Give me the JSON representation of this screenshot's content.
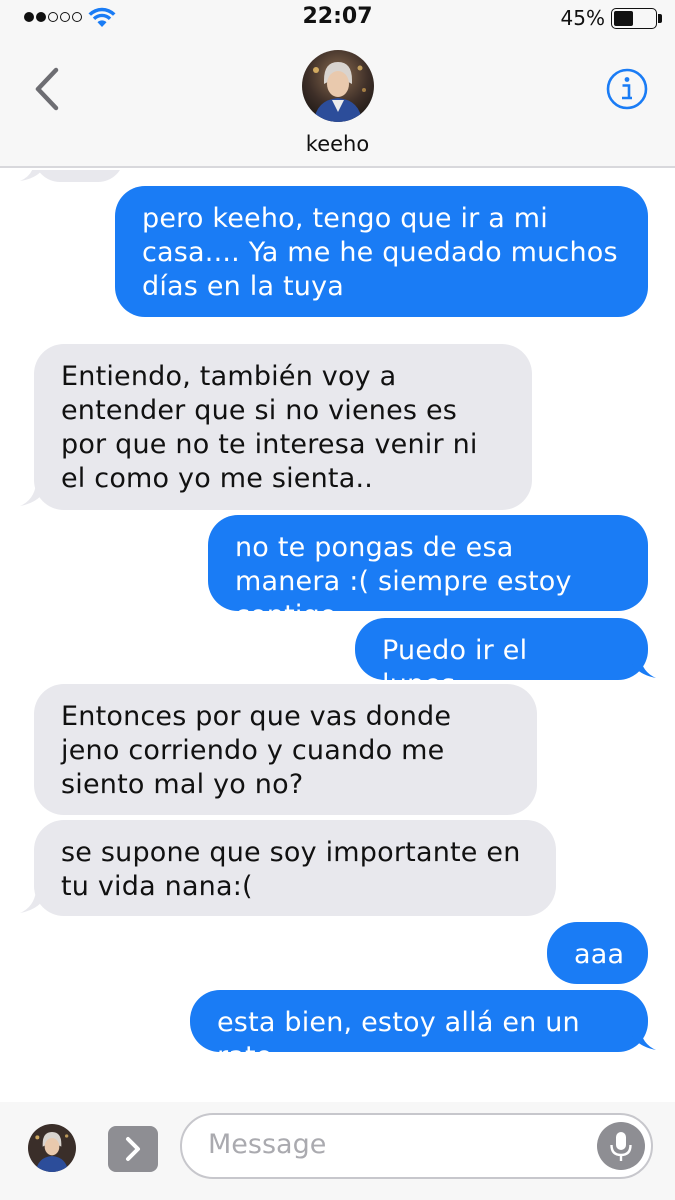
{
  "status_bar": {
    "time": "22:07",
    "battery_percent": "45%",
    "battery_level": 0.45,
    "signal_bars_filled": 2,
    "signal_bars_total": 5
  },
  "header": {
    "contact_name": "keeho",
    "back_icon": "chevron-left-icon",
    "info_icon": "info-icon"
  },
  "messages": [
    {
      "side": "sent",
      "text": "pero keeho, tengo que ir a mi casa.... Ya me he quedado muchos días en la tuya"
    },
    {
      "side": "received",
      "text": "Entiendo, también voy a entender que si no vienes es por que no te interesa venir ni el como yo me sienta.."
    },
    {
      "side": "sent",
      "text": "no te pongas de esa manera :( siempre estoy contigo"
    },
    {
      "side": "sent",
      "text": "Puedo ir el lunes..."
    },
    {
      "side": "received",
      "text": "Entonces por que vas donde jeno corriendo y cuando me siento mal yo no?"
    },
    {
      "side": "received",
      "text": "se supone que soy importante en tu vida nana:("
    },
    {
      "side": "sent",
      "text": "aaa"
    },
    {
      "side": "sent",
      "text": "esta bien, estoy allá en un rato"
    }
  ],
  "input_bar": {
    "placeholder": "Message",
    "apps_icon": "chevron-right-icon",
    "mic_icon": "microphone-icon"
  },
  "colors": {
    "sent_bubble": "#1a7cf5",
    "received_bubble": "#e8e8ed",
    "accent": "#1a7cf5"
  }
}
